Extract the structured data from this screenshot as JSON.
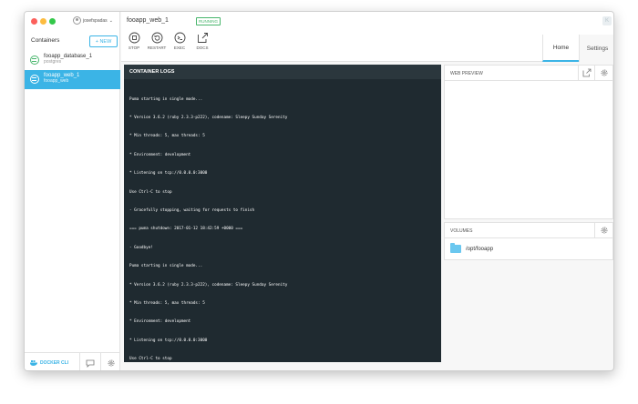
{
  "sidebar": {
    "user": "josefspadas",
    "containers_label": "Containers",
    "new_button": "+ NEW",
    "items": [
      {
        "name": "fooapp_database_1",
        "image": "postgres",
        "active": false
      },
      {
        "name": "fooapp_web_1",
        "image": "fooapp_web",
        "active": true
      }
    ],
    "footer": {
      "cli_label": "DOCKER CLI"
    }
  },
  "header": {
    "container_title": "fooapp_web_1",
    "status": "RUNNING",
    "logo": "K",
    "tools": [
      {
        "label": "STOP",
        "icon": "stop-icon"
      },
      {
        "label": "RESTART",
        "icon": "restart-icon"
      },
      {
        "label": "EXEC",
        "icon": "terminal-icon"
      },
      {
        "label": "DOCS",
        "icon": "external-link-icon"
      }
    ],
    "tabs": [
      {
        "label": "Home",
        "active": true
      },
      {
        "label": "Settings",
        "active": false
      }
    ]
  },
  "logs": {
    "title": "CONTAINER LOGS",
    "lines": [
      "Puma starting in single mode...",
      "* Version 3.6.2 (ruby 2.3.3-p222), codename: Sleepy Sunday Serenity",
      "* Min threads: 5, max threads: 5",
      "* Environment: development",
      "* Listening on tcp://0.0.0.0:3000",
      "Use Ctrl-C to stop",
      "- Gracefully stopping, waiting for requests to finish",
      "=== puma shutdown: 2017-01-12 18:42:59 +0000 ===",
      "- Goodbye!",
      "Puma starting in single mode...",
      "* Version 3.6.2 (ruby 2.3.3-p222), codename: Sleepy Sunday Serenity",
      "* Min threads: 5, max threads: 5",
      "* Environment: development",
      "* Listening on tcp://0.0.0.0:3000",
      "Use Ctrl-C to stop"
    ]
  },
  "web_preview": {
    "title": "WEB PREVIEW"
  },
  "volumes": {
    "title": "VOLUMES",
    "items": [
      "/opt/fooapp"
    ]
  },
  "colors": {
    "accent": "#3bb4e6",
    "running": "#47b56b",
    "log_bg": "#1f2a30"
  }
}
